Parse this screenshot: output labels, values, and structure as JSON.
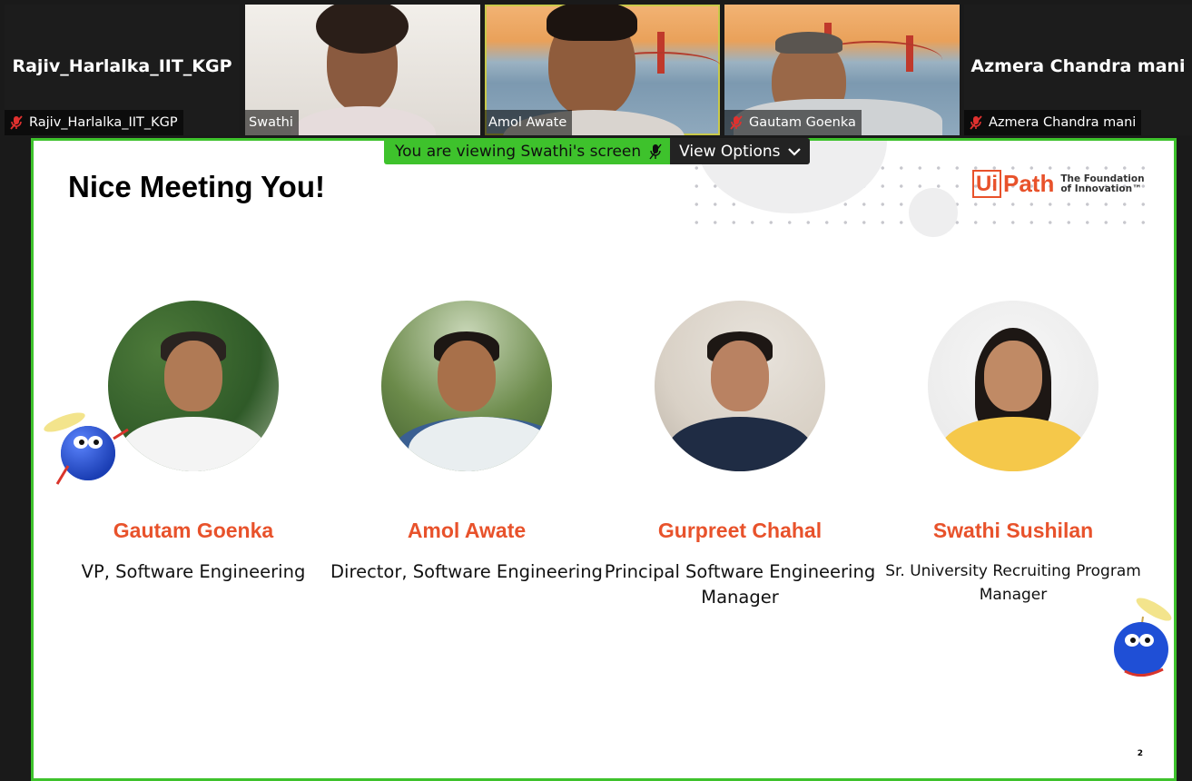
{
  "participants": [
    {
      "display": "Rajiv_Harlalka_IIT_KGP",
      "label": "Rajiv_Harlalka_IIT_KGP",
      "muted": true,
      "video": false
    },
    {
      "label": "Swathi",
      "muted": false,
      "video": true
    },
    {
      "label": "Amol Awate",
      "muted": false,
      "video": true,
      "active_speaker": true
    },
    {
      "label": "Gautam Goenka",
      "muted": true,
      "video": true
    },
    {
      "display": "Azmera Chandra mani",
      "label": "Azmera Chandra mani",
      "muted": true,
      "video": false
    }
  ],
  "share_banner": {
    "viewing_text": "You are viewing Swathi's screen",
    "options_label": "View Options"
  },
  "slide": {
    "title": "Nice Meeting You!",
    "logo": {
      "ui": "Ui",
      "path": "Path",
      "tagline_1": "The Foundation",
      "tagline_2": "of Innovation™"
    },
    "members": [
      {
        "name": "Gautam Goenka",
        "role": "VP, Software Engineering"
      },
      {
        "name": "Amol Awate",
        "role": "Director, Software Engineering"
      },
      {
        "name": "Gurpreet Chahal",
        "role": "Principal Software Engineering Manager"
      },
      {
        "name": "Swathi Sushilan",
        "role": "Sr. University Recruiting Program Manager"
      }
    ],
    "page_number": "2"
  },
  "colors": {
    "active_speaker_border": "#c9c94a",
    "share_green": "#3ec22c",
    "uipath_orange": "#e8522b",
    "mute_red": "#e0312f"
  },
  "icons": {
    "mute": "microphone-muted-icon",
    "banner_mic": "microphone-icon",
    "options": "chevron-down-icon",
    "mascot": "robot-mascot-icon"
  }
}
